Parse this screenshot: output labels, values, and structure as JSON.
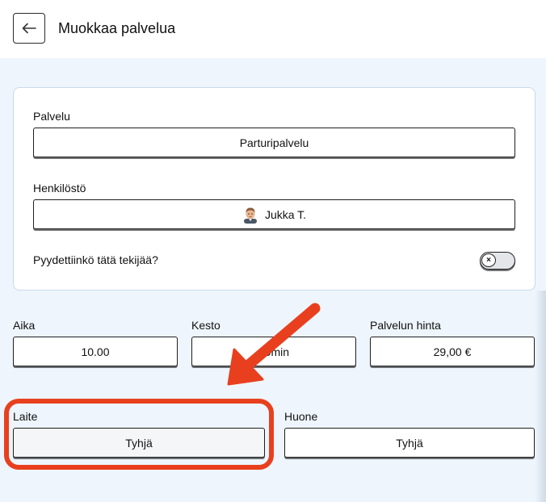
{
  "header": {
    "title": "Muokkaa palvelua",
    "back_icon": "arrow-left-icon"
  },
  "card": {
    "service_label": "Palvelu",
    "service_value": "Parturipalvelu",
    "staff_label": "Henkilöstö",
    "staff_value": "Jukka T.",
    "staff_avatar": "person-avatar-icon",
    "requested_label": "Pyydettiinkö tätä tekijää?",
    "requested_toggle": {
      "on": false,
      "icon": "x-icon",
      "glyph": "×"
    }
  },
  "timing": {
    "time_label": "Aika",
    "time_value": "10.00",
    "duration_label": "Kesto",
    "duration_value": "30min",
    "price_label": "Palvelun hinta",
    "price_value": "29,00 €"
  },
  "resources": {
    "device_label": "Laite",
    "device_value": "Tyhjä",
    "room_label": "Huone",
    "room_value": "Tyhjä"
  },
  "annotation": {
    "color": "#e8401f",
    "arrow_icon": "red-arrow-icon"
  }
}
